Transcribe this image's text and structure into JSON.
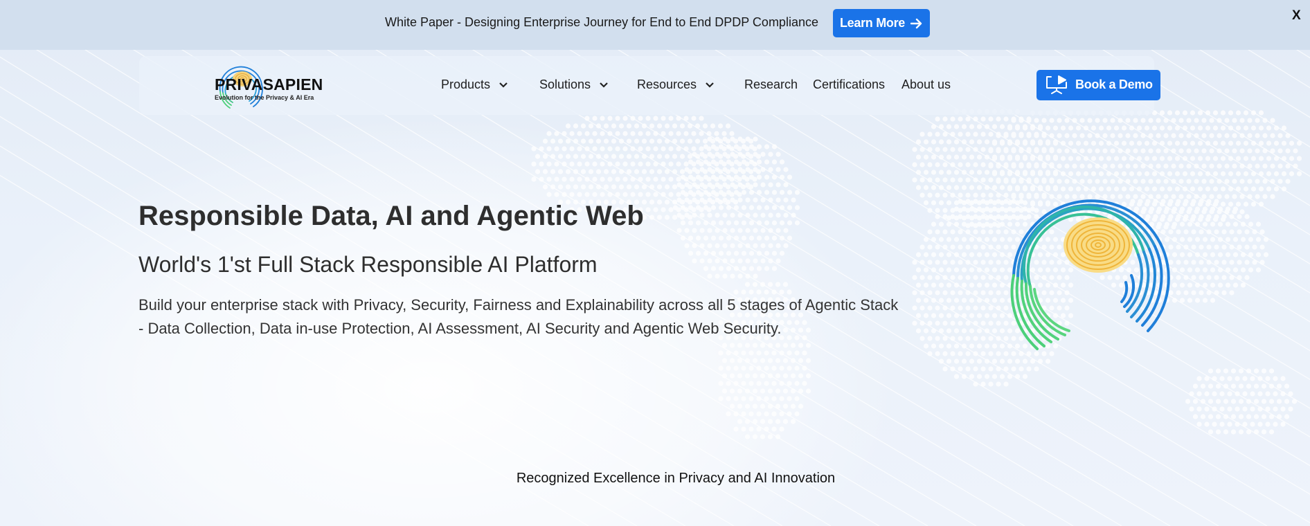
{
  "announcement": {
    "text": "White Paper - Designing Enterprise Journey for End to End DPDP Compliance",
    "button_label": "Learn More",
    "close_label": "X"
  },
  "brand": {
    "name": "PRIVASAPIEN",
    "tagline": "Evolution for the Privacy & AI Era"
  },
  "nav": {
    "items": [
      {
        "label": "Products",
        "dropdown": true
      },
      {
        "label": "Solutions",
        "dropdown": true
      },
      {
        "label": "Resources",
        "dropdown": true
      },
      {
        "label": "Research",
        "dropdown": false
      },
      {
        "label": "Certifications",
        "dropdown": false
      },
      {
        "label": "About us",
        "dropdown": false
      }
    ],
    "cta_label": "Book a Demo"
  },
  "hero": {
    "title": "Responsible Data, AI and Agentic Web",
    "subtitle": "World's 1'st Full Stack Responsible AI Platform",
    "description": "Build your enterprise stack with Privacy, Security, Fairness and Explainability across all 5 stages of Agentic Stack - Data Collection, Data in-use Protection, AI Assessment, AI Security and Agentic Web Security."
  },
  "recognition": {
    "heading": "Recognized Excellence in Privacy and AI Innovation"
  },
  "colors": {
    "accent": "#1a73e8",
    "topbar": "#d2dfee",
    "fingerprint_blue": "#1f7fd9",
    "fingerprint_green": "#4cd07a",
    "fingerprint_yellow": "#f2c24a"
  }
}
